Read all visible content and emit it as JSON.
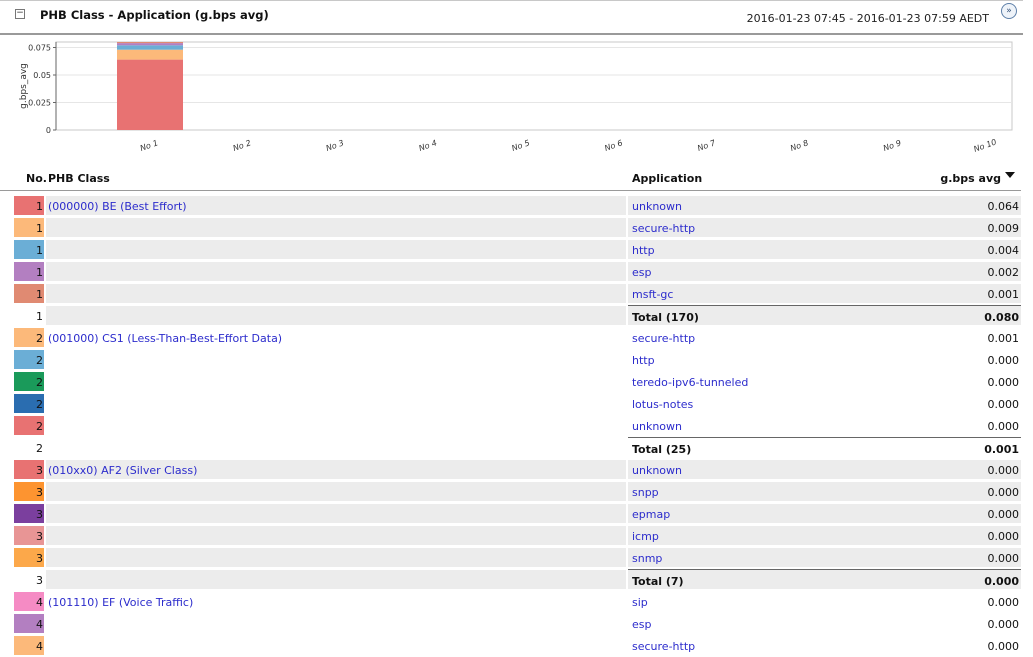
{
  "header": {
    "collapse_symbol": "−",
    "title": "PHB Class - Application  (g.bps avg)",
    "date_range": "2016-01-23 07:45  - 2016-01-23 07:59 AEDT",
    "expand_symbol": "»"
  },
  "chart_data": {
    "type": "bar",
    "stacked": true,
    "ylabel": "g.bps_avg",
    "ylim": [
      0,
      0.08
    ],
    "yticks": [
      "0",
      "0.025",
      "0.05",
      "0.075"
    ],
    "categories": [
      "No 1",
      "No 2",
      "No 3",
      "No 4",
      "No 5",
      "No 6",
      "No 7",
      "No 8",
      "No 9",
      "No 10"
    ],
    "series": [
      {
        "color": "#e87272",
        "values": [
          0.064,
          0.0,
          0.0,
          0.0,
          0.0,
          0.0,
          0.0,
          0.0,
          0.0,
          0.0
        ]
      },
      {
        "color": "#fcb97a",
        "values": [
          0.009,
          0.0,
          0.0,
          0.0,
          0.0,
          0.0,
          0.0,
          0.0,
          0.0,
          0.0
        ]
      },
      {
        "color": "#6baed6",
        "values": [
          0.004,
          0.0,
          0.0,
          0.0,
          0.0,
          0.0,
          0.0,
          0.0,
          0.0,
          0.0
        ]
      },
      {
        "color": "#b37fc1",
        "values": [
          0.002,
          0.0,
          0.0,
          0.0,
          0.0,
          0.0,
          0.0,
          0.0,
          0.0,
          0.0
        ]
      },
      {
        "color": "#e08a72",
        "values": [
          0.001,
          0.0,
          0.0,
          0.0,
          0.0,
          0.0,
          0.0,
          0.0,
          0.0,
          0.0
        ]
      }
    ]
  },
  "table": {
    "headers": {
      "no": "No.",
      "phb": "PHB Class",
      "app": "Application",
      "val": "g.bps avg"
    },
    "rows": [
      {
        "kind": "item",
        "shade": true,
        "color": "#e87272",
        "num": "1",
        "phb": "(000000) BE (Best Effort)",
        "app": "unknown",
        "val": "0.064"
      },
      {
        "kind": "item",
        "shade": true,
        "color": "#fcb97a",
        "num": "1",
        "phb": "",
        "app": "secure-http",
        "val": "0.009"
      },
      {
        "kind": "item",
        "shade": true,
        "color": "#6baed6",
        "num": "1",
        "phb": "",
        "app": "http",
        "val": "0.004"
      },
      {
        "kind": "item",
        "shade": true,
        "color": "#b37fc1",
        "num": "1",
        "phb": "",
        "app": "esp",
        "val": "0.002"
      },
      {
        "kind": "item",
        "shade": true,
        "color": "#e08a72",
        "num": "1",
        "phb": "",
        "app": "msft-gc",
        "val": "0.001"
      },
      {
        "kind": "total",
        "shade": true,
        "color": "",
        "num": "1",
        "phb": "",
        "app": "Total (170)",
        "val": "0.080"
      },
      {
        "kind": "item",
        "shade": false,
        "color": "#fcb97a",
        "num": "2",
        "phb": "(001000) CS1 (Less-Than-Best-Effort Data)",
        "app": "secure-http",
        "val": "0.001"
      },
      {
        "kind": "item",
        "shade": false,
        "color": "#6baed6",
        "num": "2",
        "phb": "",
        "app": "http",
        "val": "0.000"
      },
      {
        "kind": "item",
        "shade": false,
        "color": "#1a9a5a",
        "num": "2",
        "phb": "",
        "app": "teredo-ipv6-tunneled",
        "val": "0.000"
      },
      {
        "kind": "item",
        "shade": false,
        "color": "#2a6db0",
        "num": "2",
        "phb": "",
        "app": "lotus-notes",
        "val": "0.000"
      },
      {
        "kind": "item",
        "shade": false,
        "color": "#e87272",
        "num": "2",
        "phb": "",
        "app": "unknown",
        "val": "0.000"
      },
      {
        "kind": "total",
        "shade": false,
        "color": "",
        "num": "2",
        "phb": "",
        "app": "Total (25)",
        "val": "0.001"
      },
      {
        "kind": "item",
        "shade": true,
        "color": "#e87272",
        "num": "3",
        "phb": "(010xx0) AF2 (Silver Class)",
        "app": "unknown",
        "val": "0.000"
      },
      {
        "kind": "item",
        "shade": true,
        "color": "#fd9430",
        "num": "3",
        "phb": "",
        "app": "snpp",
        "val": "0.000"
      },
      {
        "kind": "item",
        "shade": true,
        "color": "#7b3f9e",
        "num": "3",
        "phb": "",
        "app": "epmap",
        "val": "0.000"
      },
      {
        "kind": "item",
        "shade": true,
        "color": "#e89595",
        "num": "3",
        "phb": "",
        "app": "icmp",
        "val": "0.000"
      },
      {
        "kind": "item",
        "shade": true,
        "color": "#fca84a",
        "num": "3",
        "phb": "",
        "app": "snmp",
        "val": "0.000"
      },
      {
        "kind": "total",
        "shade": true,
        "color": "",
        "num": "3",
        "phb": "",
        "app": "Total (7)",
        "val": "0.000"
      },
      {
        "kind": "item",
        "shade": false,
        "color": "#f58bc4",
        "num": "4",
        "phb": "(101110) EF (Voice Traffic)",
        "app": "sip",
        "val": "0.000"
      },
      {
        "kind": "item",
        "shade": false,
        "color": "#b37fc1",
        "num": "4",
        "phb": "",
        "app": "esp",
        "val": "0.000"
      },
      {
        "kind": "item",
        "shade": false,
        "color": "#fcb97a",
        "num": "4",
        "phb": "",
        "app": "secure-http",
        "val": "0.000"
      }
    ]
  }
}
